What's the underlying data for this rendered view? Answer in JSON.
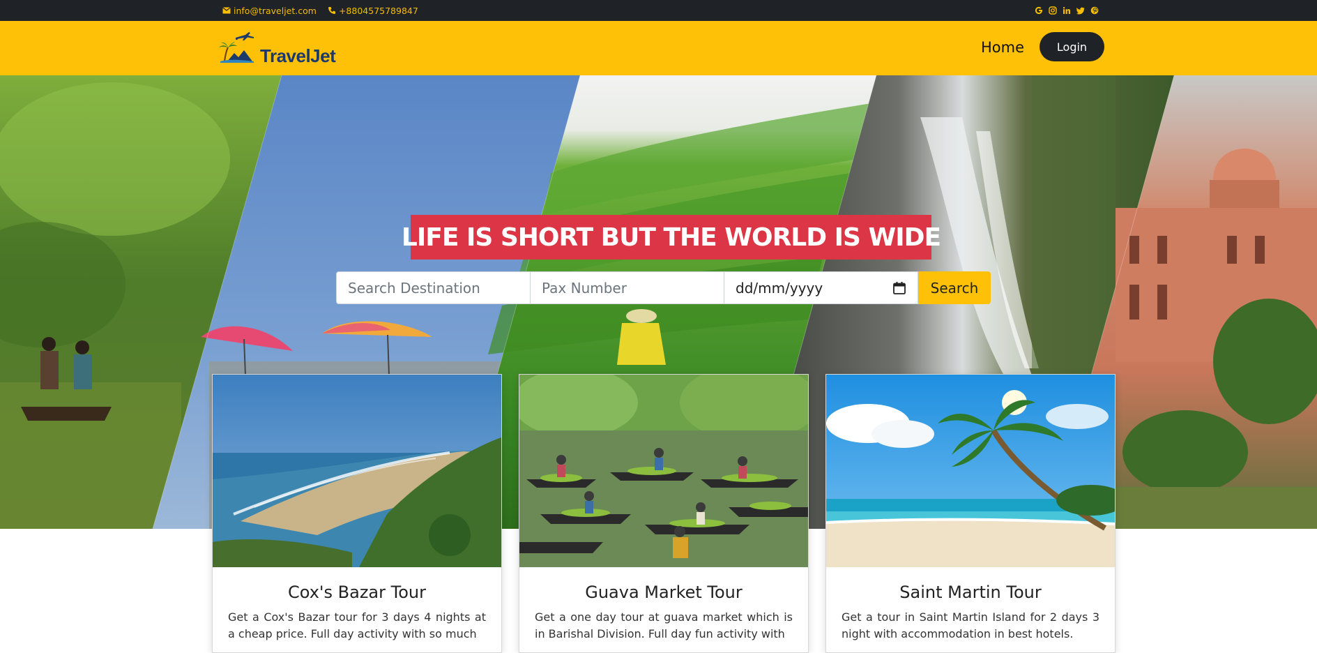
{
  "topbar": {
    "email": "info@traveljet.com",
    "phone": "+8804575789847",
    "social": [
      "google-icon",
      "instagram-icon",
      "linkedin-icon",
      "twitter-icon",
      "pinterest-icon"
    ],
    "accent": "#f5bd06",
    "background": "#1f2227"
  },
  "navbar": {
    "logo_text": "TravelJet",
    "home_label": "Home",
    "login_label": "Login",
    "background": "#fec107"
  },
  "hero": {
    "tagline": "LIFE IS SHORT BUT THE WORLD IS WIDE",
    "search": {
      "destination_placeholder": "Search Destination",
      "pax_placeholder": "Pax Number",
      "date_value": "dd/mm/yyyy",
      "button_label": "Search"
    }
  },
  "cards": [
    {
      "title": "Cox's Bazar Tour",
      "description": "Get a Cox's Bazar tour for 3 days 4 nights at a cheap price. Full day activity with so much"
    },
    {
      "title": "Guava Market Tour",
      "description": "Get a one day tour at guava market which is in Barishal Division. Full day fun activity with"
    },
    {
      "title": "Saint Martin Tour",
      "description": "Get a tour in Saint Martin Island for 2 days 3 night with accommodation in best hotels."
    }
  ]
}
